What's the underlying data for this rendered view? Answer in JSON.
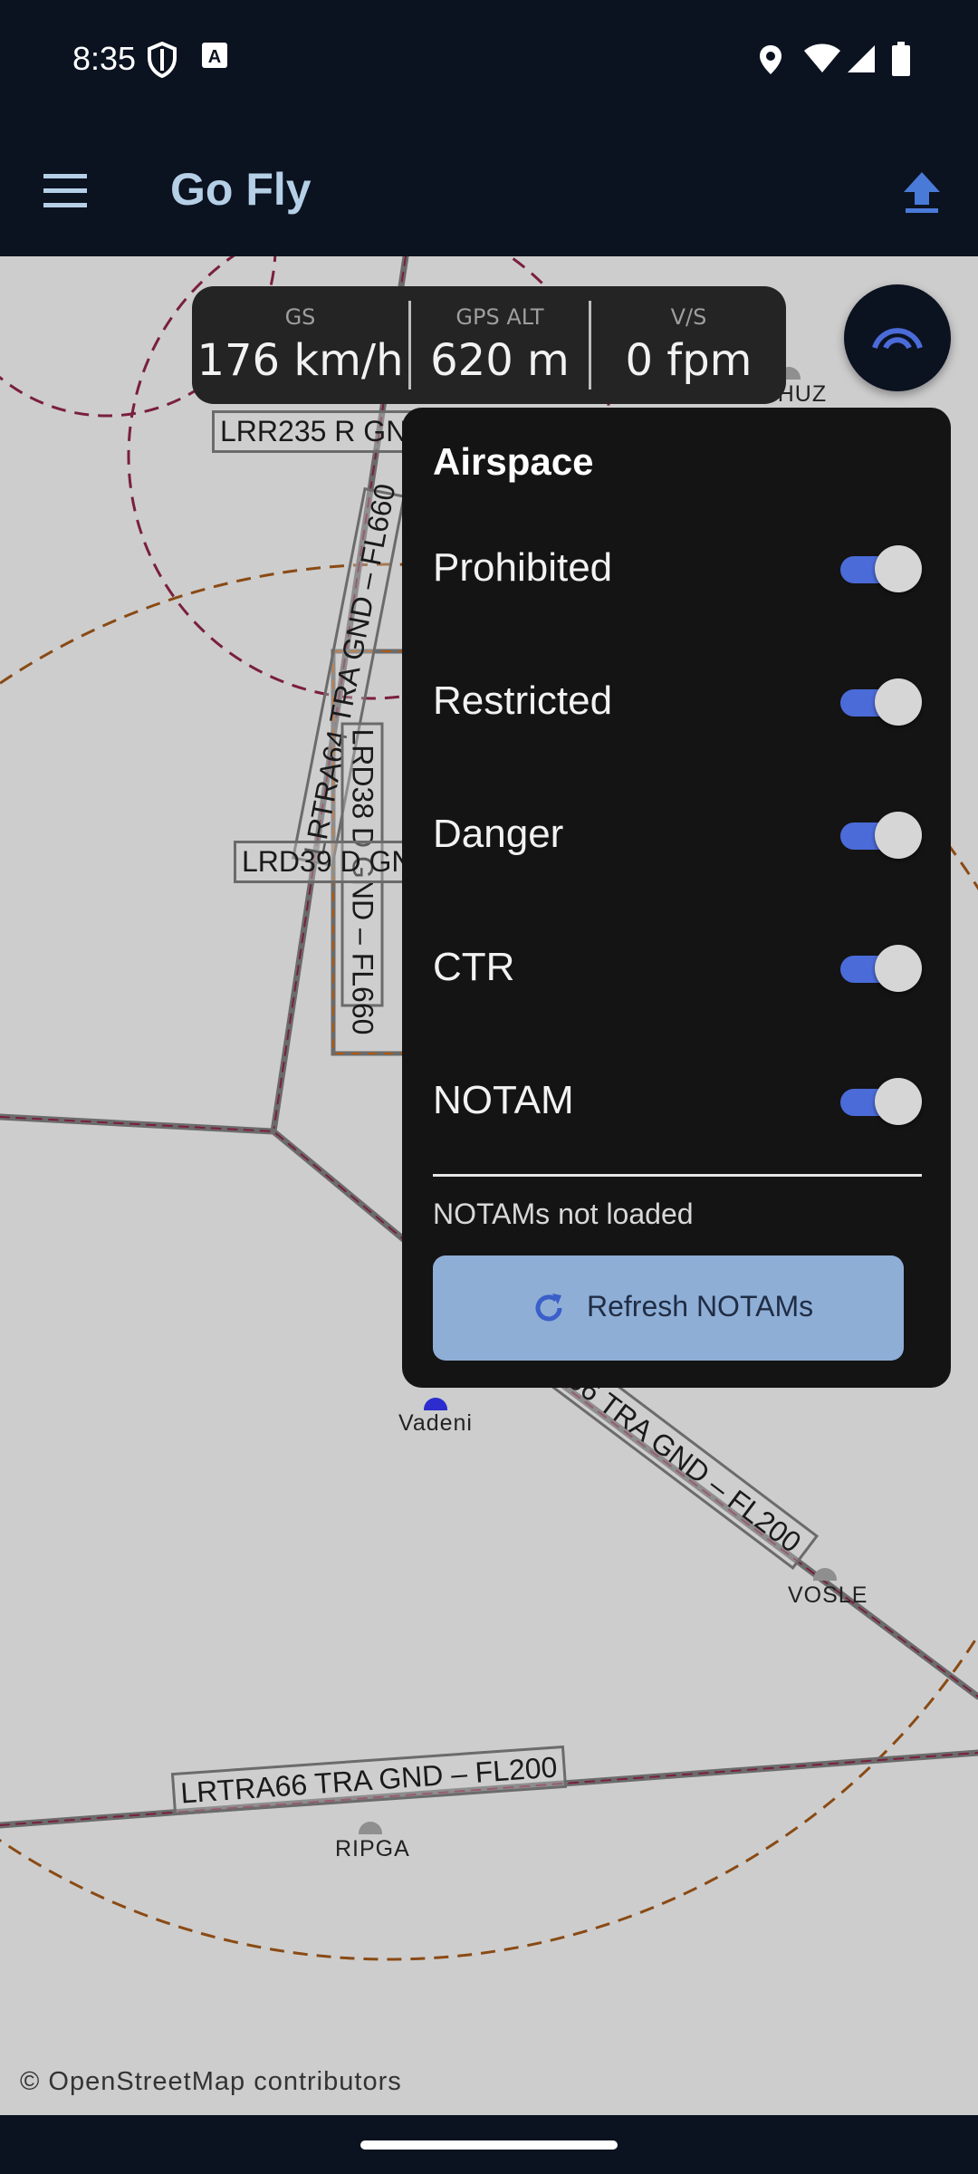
{
  "status_bar": {
    "time": "8:35",
    "left_icons": [
      "shield-icon",
      "a-box-icon"
    ],
    "right_icons": [
      "location-icon",
      "wifi-icon",
      "signal-icon",
      "battery-icon"
    ]
  },
  "app_bar": {
    "title": "Go Fly",
    "menu_icon": "hamburger-menu-icon",
    "action_icon": "upload-icon"
  },
  "flight_info": [
    {
      "label": "GS",
      "value": "176 km/h"
    },
    {
      "label": "GPS ALT",
      "value": "620 m"
    },
    {
      "label": "V/S",
      "value": "0 fpm"
    }
  ],
  "fab_icon": "signal-arcs-icon",
  "airspace_panel": {
    "heading": "Airspace",
    "items": [
      {
        "label": "Prohibited",
        "enabled": true
      },
      {
        "label": "Restricted",
        "enabled": true
      },
      {
        "label": "Danger",
        "enabled": true
      },
      {
        "label": "CTR",
        "enabled": true
      },
      {
        "label": "NOTAM",
        "enabled": true
      }
    ],
    "notam_status": "NOTAMs not loaded",
    "refresh_button": "Refresh NOTAMs"
  },
  "map": {
    "labels": {
      "lrr235": "LRR235 R GND",
      "lrtra64": "LRTRA64 TRA GND – FL660",
      "lrd38": "LRD38 D GND – FL660",
      "lrd39": "LRD39 D GN",
      "lrtra66_diag": "A66 TRA GND – FL200",
      "lrtra66": "LRTRA66 TRA GND – FL200"
    },
    "waypoints": {
      "ushuz": "USHUZ",
      "vadeni": "Vadeni",
      "vosle": "VOSLE",
      "ripga": "RIPGA"
    },
    "attribution": "© OpenStreetMap contributors"
  },
  "colors": {
    "bar_bg": "#0b1220",
    "accent": "#4a6bd8",
    "button_bg": "#8faed6",
    "map_bg": "#cdcdcd"
  }
}
